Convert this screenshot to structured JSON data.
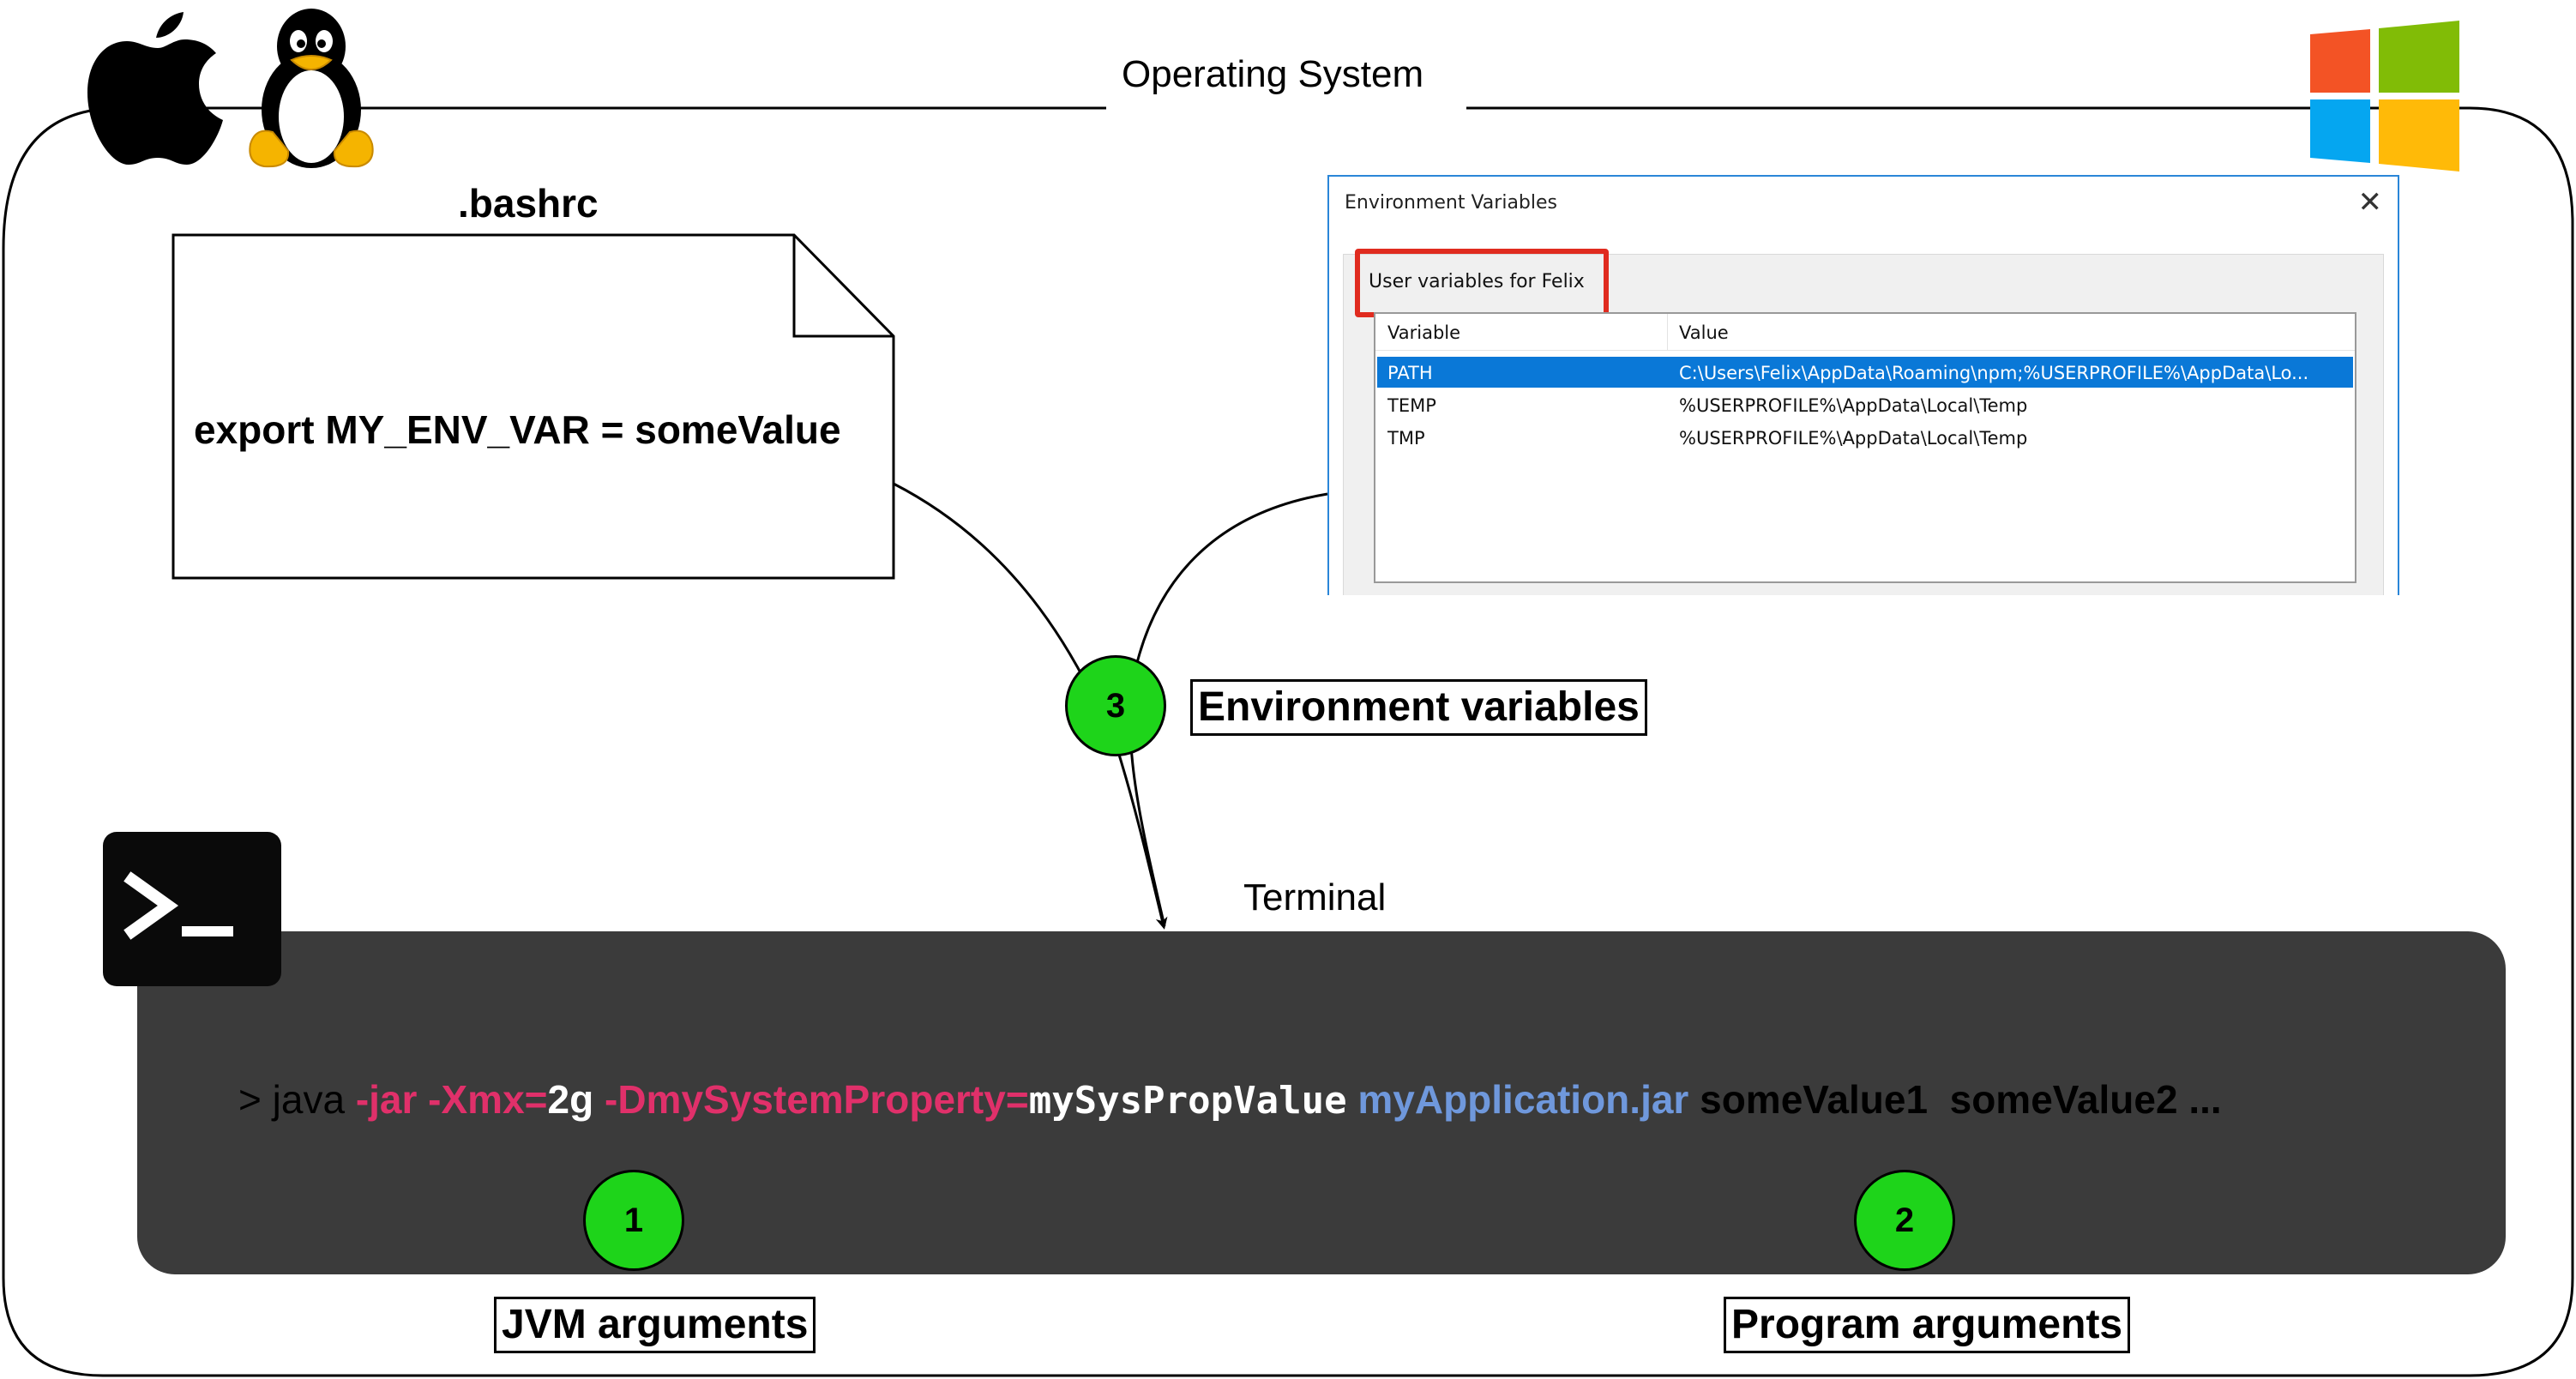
{
  "os": {
    "label": "Operating System"
  },
  "bashrc": {
    "filename": ".bashrc",
    "content": "export MY_ENV_VAR = someValue"
  },
  "env_dialog": {
    "title": "Environment Variables",
    "close_glyph": "✕",
    "group_label": "User variables for Felix",
    "columns": [
      "Variable",
      "Value"
    ],
    "rows": [
      {
        "variable": "PATH",
        "value": "C:\\Users\\Felix\\AppData\\Roaming\\npm;%USERPROFILE%\\AppData\\Lo...",
        "selected": true
      },
      {
        "variable": "TEMP",
        "value": "%USERPROFILE%\\AppData\\Local\\Temp",
        "selected": false
      },
      {
        "variable": "TMP",
        "value": "%USERPROFILE%\\AppData\\Local\\Temp",
        "selected": false
      }
    ],
    "highlight_color": "#e02b1f",
    "selection_color": "#0a78d7"
  },
  "badges": {
    "one": "1",
    "two": "2",
    "three": "3"
  },
  "labels": {
    "env_vars": "Environment variables",
    "terminal": "Terminal",
    "jvm_args": "JVM arguments",
    "program_args": "Program arguments"
  },
  "command": {
    "prompt": "> java ",
    "jvm_flags": "-jar -Xmx=",
    "heap_value": "2g",
    "sysprop_flag": " -DmySystemProperty=",
    "sysprop_value": "mySysPropValue",
    "jar": " myApplication.jar",
    "program_args": " someValue1  someValue2 ..."
  },
  "colors": {
    "terminal_bg": "#3b3b3b",
    "jvm_flag": "#e0306a",
    "jar_name": "#6f98dc",
    "badge_green": "#1ed41a",
    "windows_red": "#f35325",
    "windows_green": "#81bc06",
    "windows_blue": "#05a6f0",
    "windows_yellow": "#ffba08"
  },
  "icons": [
    "apple-logo-icon",
    "linux-tux-icon",
    "windows-logo-icon",
    "terminal-prompt-icon"
  ]
}
